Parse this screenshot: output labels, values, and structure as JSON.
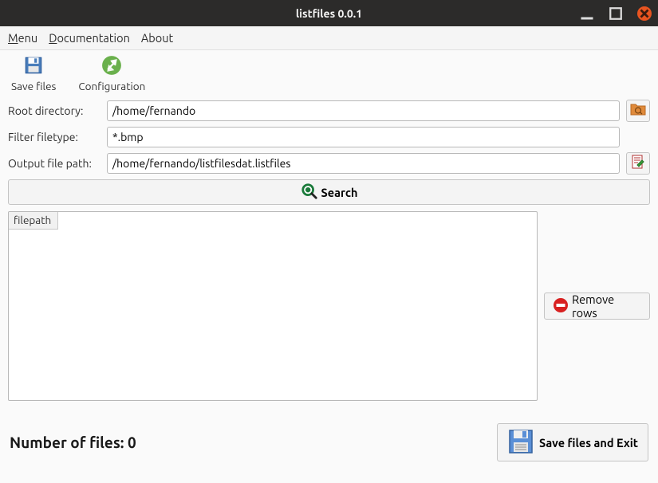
{
  "window": {
    "title": "listfiles 0.0.1"
  },
  "menubar": {
    "menu": "Menu",
    "documentation": "Documentation",
    "about": "About"
  },
  "toolbar": {
    "save_files": "Save files",
    "configuration": "Configuration"
  },
  "form": {
    "root_dir_label": "Root directory:",
    "root_dir_value": "/home/fernando",
    "filter_label": "Filter filetype:",
    "filter_value": "*.bmp",
    "output_label": "Output file path:",
    "output_value": "/home/fernando/listfilesdat.listfiles"
  },
  "search": {
    "label": "Search"
  },
  "table": {
    "header": "filepath"
  },
  "remove_rows": {
    "label": "Remove rows"
  },
  "footer": {
    "count_text": "Number of files: 0",
    "save_exit": "Save files and Exit"
  }
}
